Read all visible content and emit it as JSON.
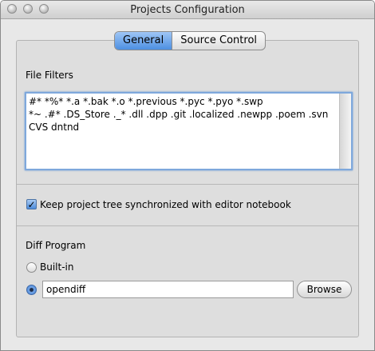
{
  "window": {
    "title": "Projects Configuration"
  },
  "tabs": [
    {
      "label": "General",
      "active": true
    },
    {
      "label": "Source Control",
      "active": false
    }
  ],
  "file_filters": {
    "label": "File Filters",
    "lines": [
      "#* *%* *.a *.bak *.o *.previous *.pyc *.pyo *.swp",
      "*~ .#* .DS_Store ._* .dll .dpp .git .localized .newpp .poem .svn",
      "CVS dntnd"
    ]
  },
  "keep_sync": {
    "label": "Keep project tree synchronized with editor notebook",
    "checked": true
  },
  "diff": {
    "label": "Diff Program",
    "builtin_label": "Built-in",
    "builtin_selected": false,
    "custom_selected": true,
    "custom_value": "opendiff",
    "browse_label": "Browse"
  }
}
